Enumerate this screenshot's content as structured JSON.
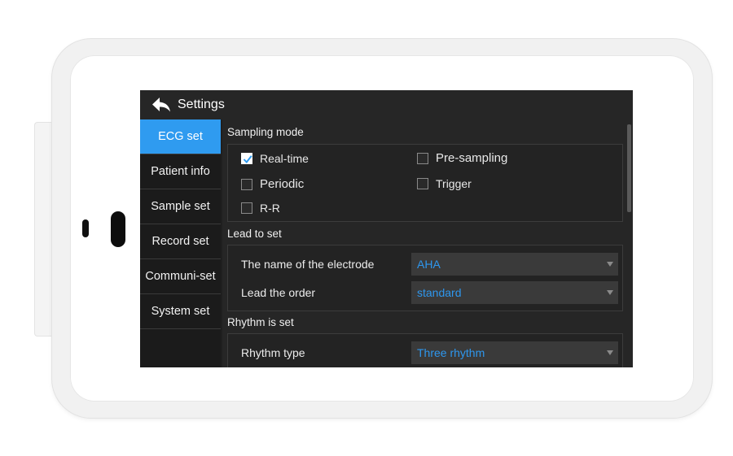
{
  "header": {
    "title": "Settings",
    "back_icon": "arrow-back-icon"
  },
  "sidebar": {
    "items": [
      {
        "label": "ECG set",
        "active": true
      },
      {
        "label": "Patient info",
        "active": false
      },
      {
        "label": "Sample set",
        "active": false
      },
      {
        "label": "Record set",
        "active": false
      },
      {
        "label": "Communi-set",
        "active": false
      },
      {
        "label": "System set",
        "active": false
      }
    ]
  },
  "sampling_mode": {
    "title": "Sampling mode",
    "options": [
      {
        "label": "Real-time",
        "checked": true
      },
      {
        "label": "Pre-sampling",
        "checked": false
      },
      {
        "label": "Periodic",
        "checked": false
      },
      {
        "label": "Trigger",
        "checked": false
      },
      {
        "label": "R-R",
        "checked": false
      }
    ]
  },
  "lead_to_set": {
    "title": "Lead to set",
    "electrode_label": "The name of the electrode",
    "electrode_value": "AHA",
    "order_label": "Lead the order",
    "order_value": "standard"
  },
  "rhythm": {
    "title": "Rhythm is set",
    "type_label": "Rhythm type",
    "type_value": "Three rhythm"
  },
  "colors": {
    "accent": "#2f9bf0",
    "value_text": "#2e97ee",
    "background": "#262626"
  }
}
